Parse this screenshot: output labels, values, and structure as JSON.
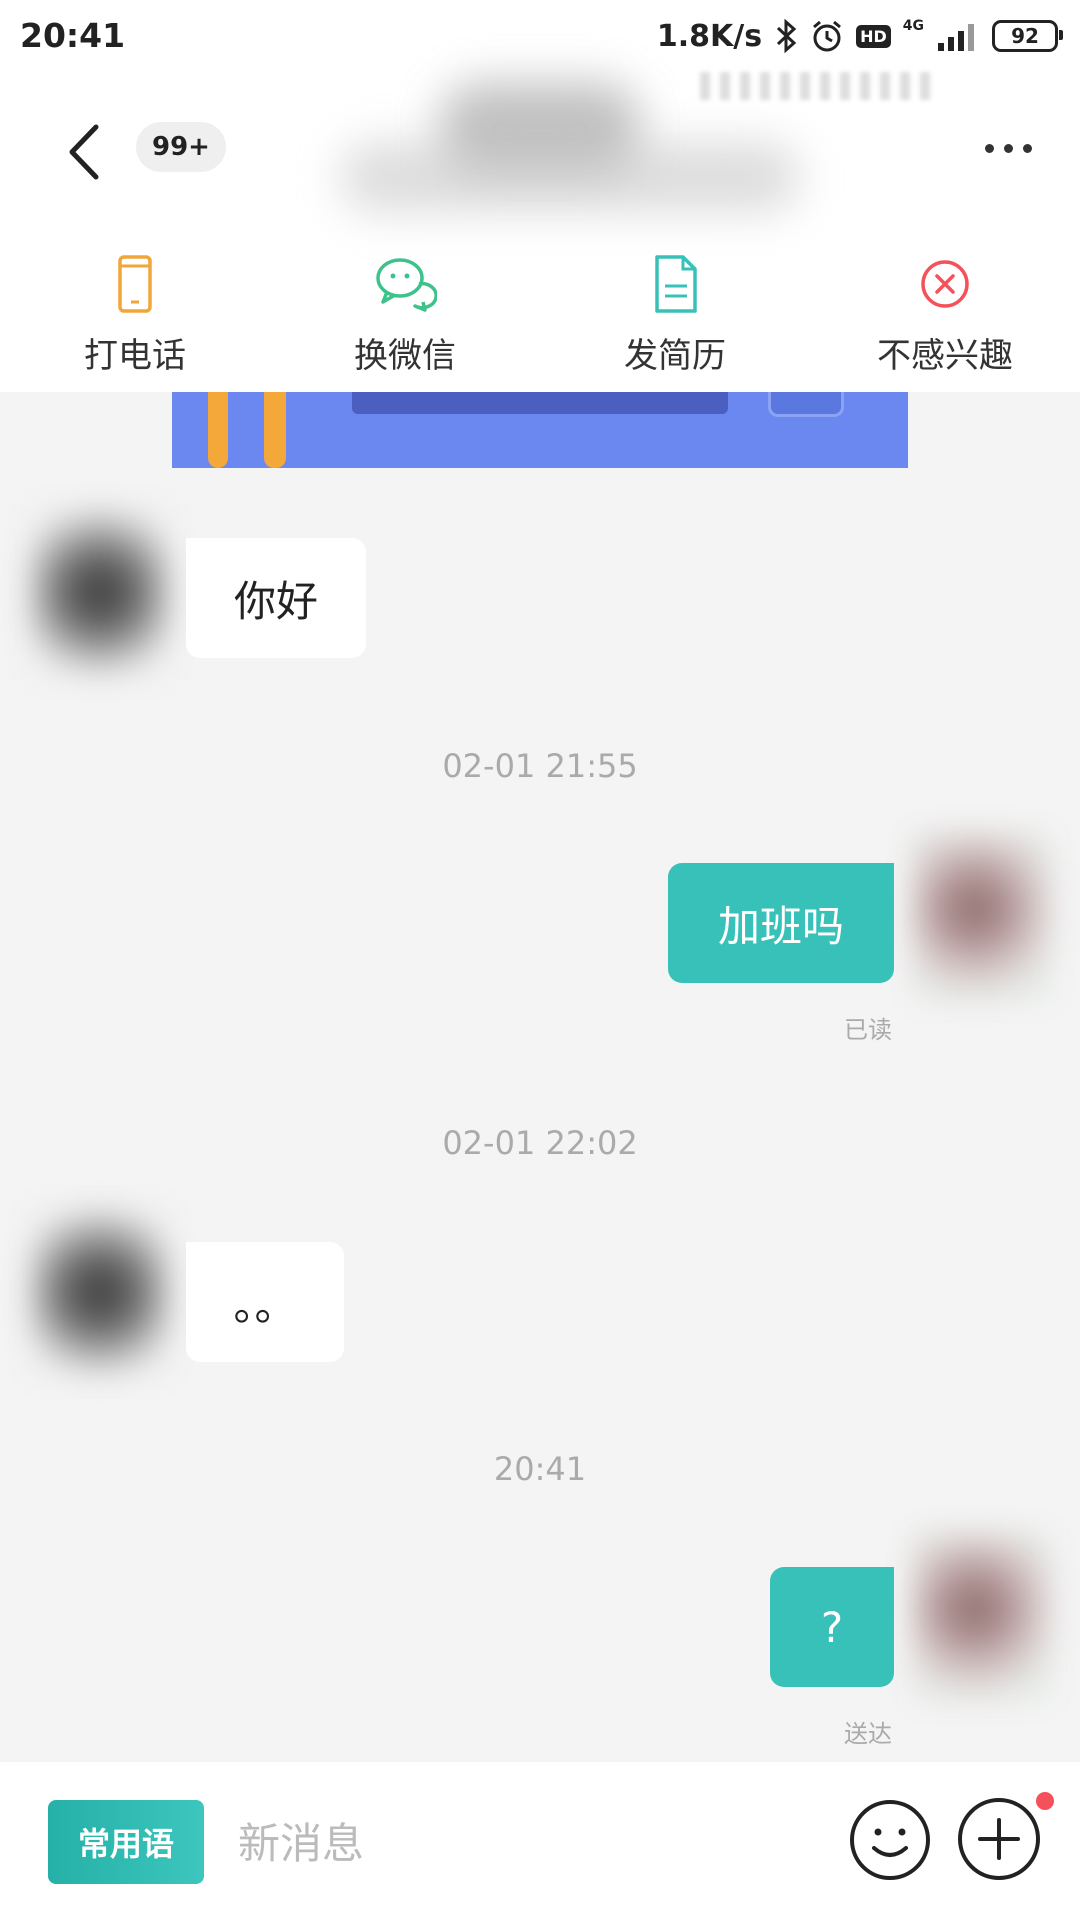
{
  "status_bar": {
    "time": "20:41",
    "net_speed": "1.8K/s",
    "hd": "HD",
    "net_type": "4G",
    "battery": "92",
    "icons": [
      "bluetooth-icon",
      "alarm-icon",
      "signal-icon",
      "battery-icon"
    ]
  },
  "header": {
    "unread_count": "99+",
    "actions": [
      {
        "label": "打电话",
        "icon": "phone-icon",
        "color": "#f0a63a"
      },
      {
        "label": "换微信",
        "icon": "wechat-icon",
        "color": "#3cc28a"
      },
      {
        "label": "发简历",
        "icon": "resume-icon",
        "color": "#38c1b9"
      },
      {
        "label": "不感兴趣",
        "icon": "not-interested-icon",
        "color": "#f4515a"
      }
    ]
  },
  "messages": [
    {
      "from": "other",
      "text": "你好"
    },
    {
      "timestamp": "02-01 21:55"
    },
    {
      "from": "self",
      "text": "加班吗",
      "status": "已读"
    },
    {
      "timestamp": "02-01 22:02"
    },
    {
      "from": "other",
      "text": "。。"
    },
    {
      "timestamp": "20:41"
    },
    {
      "from": "self",
      "text": "?",
      "status": "送达"
    }
  ],
  "composer": {
    "phrases_label": "常用语",
    "placeholder": "新消息"
  },
  "colors": {
    "accent": "#38c1b9",
    "background": "#f4f4f4",
    "badge_dot": "#f4515a"
  }
}
